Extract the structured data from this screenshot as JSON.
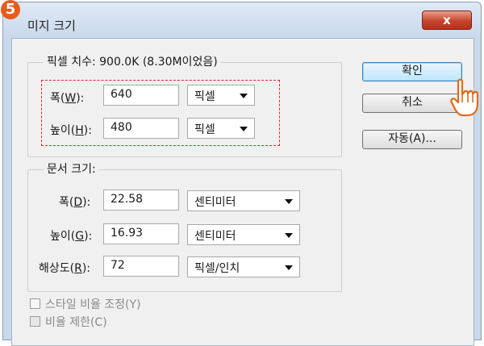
{
  "window": {
    "step_number": "5",
    "title": "미지 크기",
    "close_glyph": "x"
  },
  "pixel_dimensions": {
    "legend": "픽셀 치수: 900.0K (8.30M이었음)",
    "width": {
      "label_pre": "폭(",
      "mnemonic": "W",
      "label_post": "):",
      "value": "640",
      "unit": "픽셀"
    },
    "height": {
      "label_pre": "높이(",
      "mnemonic": "H",
      "label_post": "):",
      "value": "480",
      "unit": "픽셀"
    }
  },
  "document_size": {
    "legend": "문서 크기:",
    "width": {
      "label_pre": "폭(",
      "mnemonic": "D",
      "label_post": "):",
      "value": "22.58",
      "unit": "센티미터"
    },
    "height": {
      "label_pre": "높이(",
      "mnemonic": "G",
      "label_post": "):",
      "value": "16.93",
      "unit": "센티미터"
    },
    "resolution": {
      "label_pre": "해상도(",
      "mnemonic": "R",
      "label_post": "):",
      "value": "72",
      "unit": "픽셀/인치"
    }
  },
  "options": {
    "constrain_styles_label": "스타일 비율 조정(Y)",
    "constrain_styles_checked": false,
    "constrain_proportions_label": "비율 제한(C)",
    "constrain_proportions_checked": true
  },
  "buttons": {
    "ok": "확인",
    "cancel": "취소",
    "auto": "자동(A)..."
  },
  "colors": {
    "highlight_dash": "#e0262f",
    "badge": "#ea5a1c",
    "close_button": "#c7442c"
  }
}
